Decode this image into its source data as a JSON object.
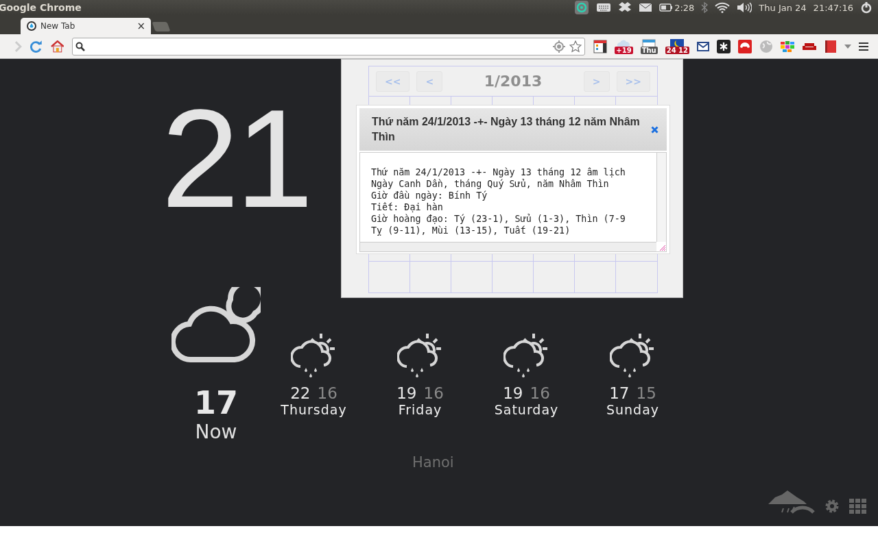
{
  "top_panel": {
    "app_name": "Google Chrome",
    "battery_time": "2:28",
    "date": "Thu Jan 24",
    "time": "21:47:16"
  },
  "tabs": [
    {
      "title": "New Tab",
      "close": "×",
      "selected": true
    }
  ],
  "toolbar": {
    "extension_badges": [
      "+19",
      "Thu",
      "24 12"
    ]
  },
  "clock": {
    "hours": "21"
  },
  "calendar_popup": {
    "prev_buttons": [
      "<<",
      "<"
    ],
    "month": "1/2013",
    "next_buttons": [
      ">",
      ">>"
    ],
    "dialog": {
      "title": "Thứ năm 24/1/2013 -+- Ngày 13 tháng 12 năm Nhâm Thìn",
      "lines": [
        "Thứ năm 24/1/2013 -+- Ngày 13 tháng 12 âm lịch",
        "Ngày Canh Dần, tháng Quý Sửu, năm Nhâm Thìn",
        "Giờ đầu ngày: Bính Tý",
        "Tiết: Đại hàn",
        "Giờ hoàng đạo: Tý (23-1), Sửu (1-3), Thìn (7-9",
        "Tỵ (9-11), Mùi (13-15), Tuất (19-21)"
      ]
    }
  },
  "weather": {
    "current": {
      "temp": "17",
      "label": "Now"
    },
    "forecast": [
      {
        "high": "22",
        "low": "16",
        "day": "Thursday"
      },
      {
        "high": "19",
        "low": "16",
        "day": "Friday"
      },
      {
        "high": "19",
        "low": "16",
        "day": "Saturday"
      },
      {
        "high": "17",
        "low": "15",
        "day": "Sunday"
      }
    ],
    "city": "Hanoi"
  }
}
